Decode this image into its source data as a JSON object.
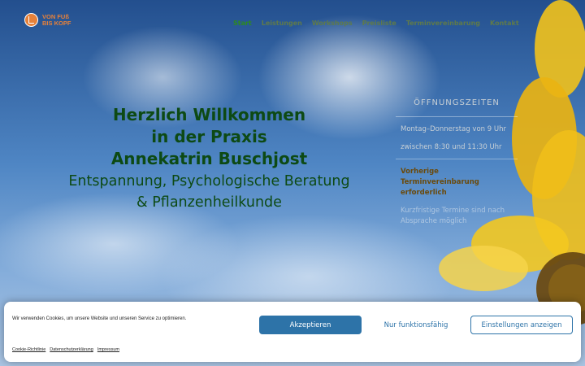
{
  "logo": {
    "line1": "VON FUß",
    "line2": "BIS KOPF"
  },
  "nav": {
    "items": [
      {
        "label": "Start",
        "active": true
      },
      {
        "label": "Leistungen"
      },
      {
        "label": "Workshops"
      },
      {
        "label": "Preisliste"
      },
      {
        "label": "Terminvereinbarung"
      },
      {
        "label": "Kontakt"
      }
    ]
  },
  "welcome": {
    "line1": "Herzlich Willkommen",
    "line2": "in der Praxis",
    "line3": "Annekatrin  Buschjost",
    "sub1": "Entspannung, Psychologische Beratung",
    "sub2": "& Pflanzenheilkunde"
  },
  "info": {
    "heading": "ÖFFNUNGSZEITEN",
    "p1": "Montag–Donnerstag von 9 Uhr",
    "p2": "zwischen 8:30 und 11:30 Uhr",
    "warn": "Vorherige Terminvereinbarung erforderlich",
    "faint": "Kurzfristige Termine sind nach Absprache möglich"
  },
  "cookie": {
    "text": "Wir verwenden Cookies, um unsere Website und unseren Service zu optimieren.",
    "accept": "Akzeptieren",
    "functional": "Nur funktionsfähig",
    "settings": "Einstellungen anzeigen",
    "links": [
      "Cookie-Richtlinie",
      "Datenschutzerklärung",
      "Impressum"
    ]
  },
  "colors": {
    "brand_orange": "#e6813a",
    "heading_green": "#0d4a14",
    "nav_active": "#2d8b1e",
    "button_blue": "#2d73a8"
  }
}
